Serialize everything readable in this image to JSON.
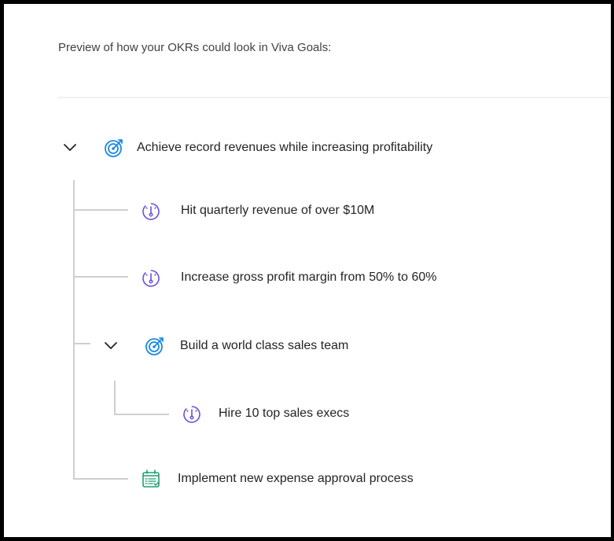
{
  "header": {
    "preview_text": "Preview of how your OKRs could look in Viva Goals:"
  },
  "colors": {
    "objective_icon": "#1b8ae0",
    "key_result_icon": "#6b4fd8",
    "project_icon": "#1f9e74",
    "tree_line": "#cfcfcf"
  },
  "okr_tree": {
    "objective": {
      "label": "Achieve record revenues while increasing profitability",
      "icon": "target-icon",
      "expanded": true
    },
    "key_results": [
      {
        "label": "Hit quarterly revenue of over $10M",
        "icon": "gauge-icon"
      },
      {
        "label": "Increase gross profit margin from 50% to 60%",
        "icon": "gauge-icon"
      }
    ],
    "sub_objective": {
      "label": "Build a world class sales team",
      "icon": "target-icon",
      "expanded": true,
      "key_result": {
        "label": "Hire 10 top sales execs",
        "icon": "gauge-icon"
      }
    },
    "project": {
      "label": "Implement new expense approval process",
      "icon": "calendar-checklist-icon"
    }
  }
}
